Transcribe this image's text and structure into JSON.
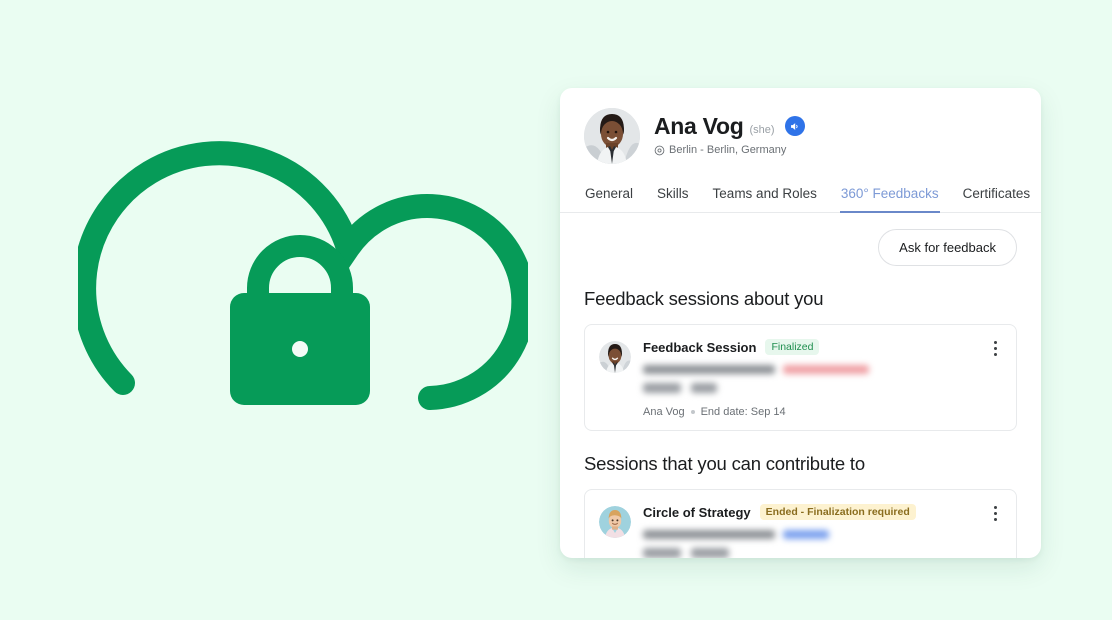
{
  "illustration": {
    "name": "cloud-lock-illustration",
    "cloud_icon": "cloud-outline-icon",
    "lock_icon": "padlock-icon",
    "accent_color": "#069B58",
    "background_color": "#EAFDF2"
  },
  "profile": {
    "avatar_name": "ana-vog-avatar",
    "name": "Ana Vog",
    "pronoun": "(she)",
    "audio_icon": "speaker-pronunciation-icon",
    "location_icon": "location-pin-icon",
    "location": "Berlin - Berlin, Germany"
  },
  "tabs": [
    {
      "label": "General",
      "active": false
    },
    {
      "label": "Skills",
      "active": false
    },
    {
      "label": "Teams and Roles",
      "active": false
    },
    {
      "label": "360° Feedbacks",
      "active": true
    },
    {
      "label": "Certificates",
      "active": false
    }
  ],
  "toolbar": {
    "ask_for_feedback_label": "Ask for feedback"
  },
  "sections": [
    {
      "title": "Feedback sessions about you",
      "card": {
        "avatar_name": "session-owner-avatar",
        "title": "Feedback Session",
        "badge_label": "Finalized",
        "badge_style": "green",
        "redacted_status_color": "#F0A0A4",
        "owner": "Ana Vog",
        "end_date": "End date: Sep 14",
        "menu_icon": "kebab-menu-icon"
      }
    },
    {
      "title": "Sessions that you can contribute to",
      "card": {
        "avatar_name": "session-contributor-avatar",
        "title": "Circle of Strategy",
        "badge_label": "Ended - Finalization required",
        "badge_style": "amber",
        "redacted_status_color": "#7AA0EE",
        "menu_icon": "kebab-menu-icon"
      }
    }
  ],
  "colors": {
    "accent_green": "#069B58",
    "active_tab_blue": "#7D9AD6",
    "audio_badge_blue": "#2F73E8",
    "page_background": "#EAFDF2",
    "panel_background": "#FFFFFF"
  }
}
